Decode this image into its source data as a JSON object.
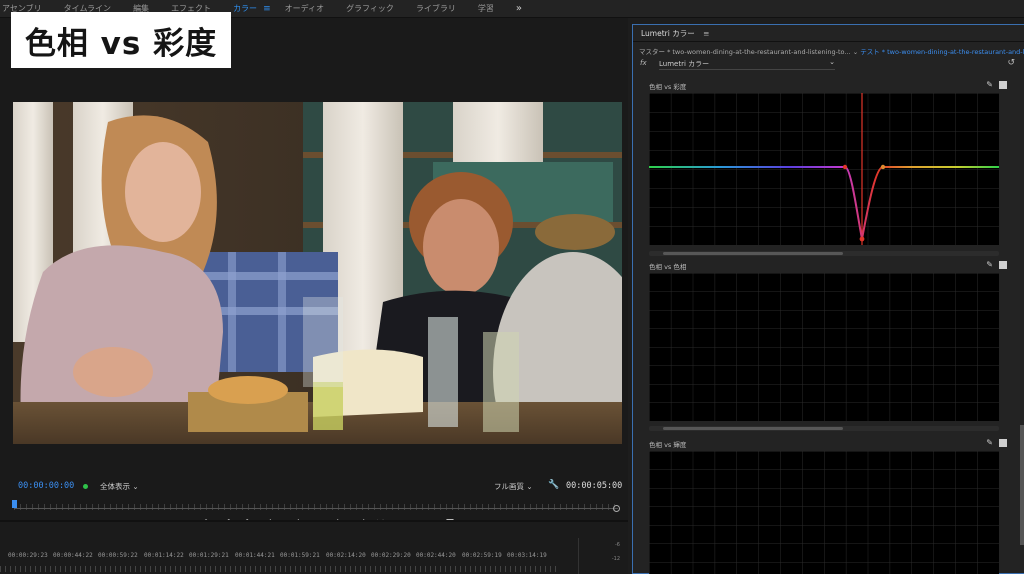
{
  "topbar": {
    "workspaces": [
      "アセンブリ",
      "タイムライン",
      "編集",
      "エフェクト",
      "カラー",
      "オーディオ",
      "グラフィック",
      "ライブラリ",
      "学習"
    ],
    "active_index": 4,
    "menu_icon": "hamburger-icon",
    "more_icon": "double-chevron-right-icon"
  },
  "overlay_title": "色相 vs 彩度",
  "monitor": {
    "timecode_current": "00:00:00:00",
    "fit_label": "全体表示",
    "resolution_label": "フル画質",
    "timecode_duration": "00:00:05:00"
  },
  "timeline": {
    "ruler_labels": [
      "00:00:29:23",
      "00:00:44:22",
      "00:00:59:22",
      "00:01:14:22",
      "00:01:29:21",
      "00:01:44:21",
      "00:01:59:21",
      "00:02:14:20",
      "00:02:29:20",
      "00:02:44:20",
      "00:02:59:19",
      "00:03:14:19"
    ],
    "meter_labels": [
      "-6",
      "-12"
    ]
  },
  "lumetri": {
    "panel_title": "Lumetri カラー",
    "master_prefix": "マスター * two-women-dining-at-the-restaurant-and-listening-to...",
    "test_prefix": "テスト * two-women-dining-at-the-restaurant-and-listening-to...",
    "fx_label": "fx",
    "effect_select": "Lumetri カラー",
    "sections": [
      {
        "label": "色相 vs 彩度"
      },
      {
        "label": "色相 vs 色相"
      },
      {
        "label": "色相 vs 輝度"
      }
    ]
  },
  "colors": {
    "accent": "#2f8ff0",
    "panel_border": "#3a6fb0",
    "curve_red": "#e0352a"
  }
}
